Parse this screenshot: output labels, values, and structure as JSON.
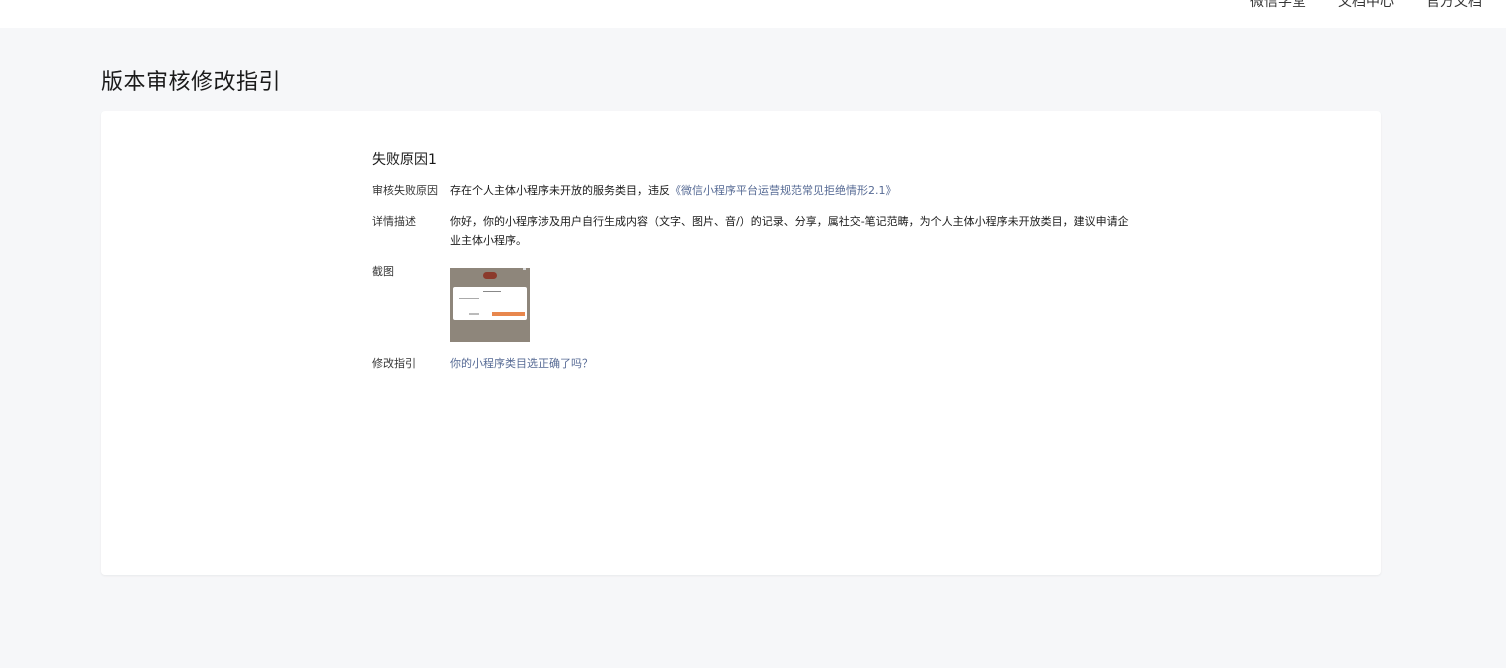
{
  "topnav": {
    "items": [
      "微信学堂",
      "文档中心",
      "官方文档"
    ]
  },
  "page": {
    "title": "版本审核修改指引"
  },
  "reason": {
    "title": "失败原因1",
    "fail_reason_label": "审核失败原因",
    "fail_reason_text": "存在个人主体小程序未开放的服务类目，违反",
    "fail_reason_link": "《微信小程序平台运营规范常见拒绝情形2.1》",
    "detail_label": "详情描述",
    "detail_text": "你好，你的小程序涉及用户自行生成内容（文字、图片、音/）的记录、分享，属社交-笔记范畴，为个人主体小程序未开放类目，建议申请企业主体小程序。",
    "screenshot_label": "截图",
    "guide_label": "修改指引",
    "guide_link": "你的小程序类目选正确了吗？"
  },
  "colors": {
    "link": "#576b95",
    "background": "#f6f7f9",
    "thumb_background": "#8e867b",
    "thumb_button": "#e8874d"
  }
}
